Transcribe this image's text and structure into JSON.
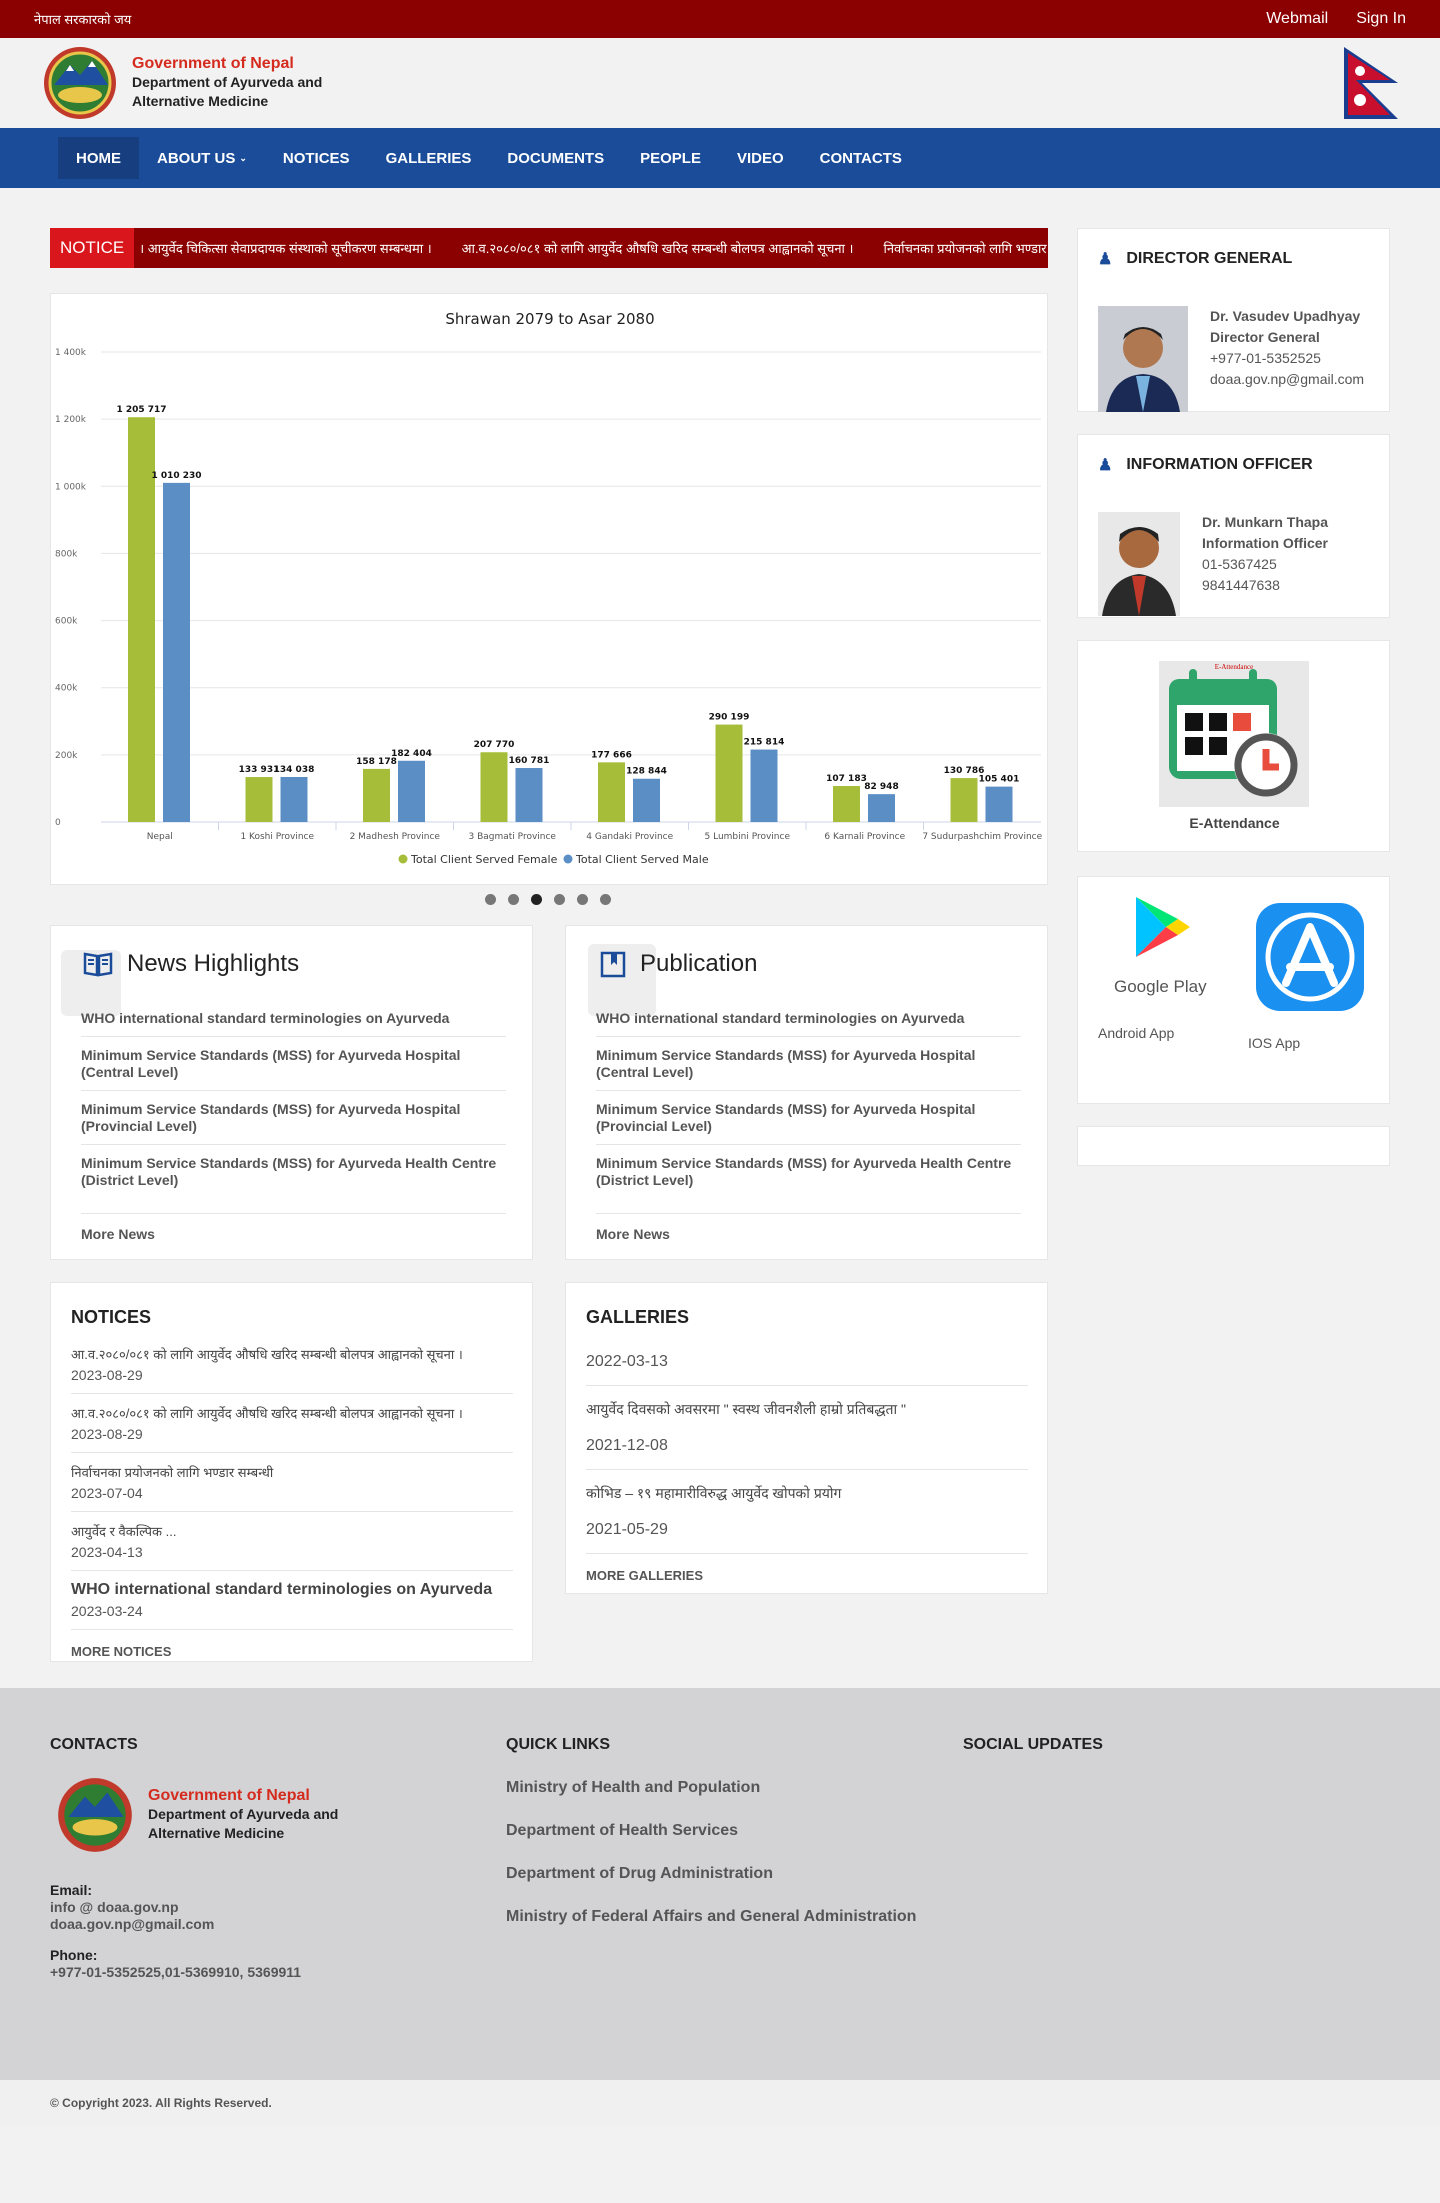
{
  "topbar": {
    "left_text": "नेपाल सरकारको जय",
    "webmail": "Webmail",
    "signin": "Sign In"
  },
  "brand": {
    "line1": "Government of Nepal",
    "line2": "Department of Ayurveda and",
    "line3": "Alternative Medicine"
  },
  "nav": {
    "items": [
      "HOME",
      "ABOUT US",
      "NOTICES",
      "GALLERIES",
      "DOCUMENTS",
      "PEOPLE",
      "VIDEO",
      "CONTACTS"
    ]
  },
  "ticker": {
    "label": "NOTICE",
    "items": [
      "। आयुर्वेद चिकित्सा सेवाप्रदायक संस्थाको सूचीकरण सम्बन्धमा ।",
      "आ.व.२०८०/०८१ को लागि आयुर्वेद औषधि खरिद सम्बन्धी बोलपत्र आह्वानको सूचना ।",
      "निर्वाचनका प्रयोजनको लागि भण्डार सम्बन्धी"
    ]
  },
  "chart_data": {
    "type": "bar",
    "title": "Shrawan 2079 to Asar 2080",
    "categories": [
      "Nepal",
      "1 Koshi Province",
      "2 Madhesh Province",
      "3 Bagmati Province",
      "4 Gandaki Province",
      "5 Lumbini Province",
      "6 Karnali Province",
      "7 Sudurpashchim Province"
    ],
    "series": [
      {
        "name": "Total Client Served Female",
        "color": "#a6bd3a",
        "values": [
          1205717,
          133931,
          158178,
          207770,
          177666,
          290199,
          107183,
          130786
        ],
        "labels": [
          "1 205 717",
          "133 931",
          "158 178",
          "207 770",
          "177 666",
          "290 199",
          "107 183",
          "130 786"
        ]
      },
      {
        "name": "Total Client Served Male",
        "color": "#5b8ec4",
        "values": [
          1010230,
          134038,
          182404,
          160781,
          128844,
          215814,
          82948,
          105401
        ],
        "labels": [
          "1 010 230",
          "134 038",
          "182 404",
          "160 781",
          "128 844",
          "215 814",
          "82 948",
          "105 401"
        ]
      }
    ],
    "yticks": [
      "0",
      "200k",
      "400k",
      "600k",
      "800k",
      "1 000k",
      "1 200k",
      "1 400k"
    ],
    "ylim": [
      0,
      1400000
    ],
    "grid": true,
    "legend": "bottom"
  },
  "news": {
    "title": "News Highlights",
    "items": [
      "WHO international standard terminologies on Ayurveda",
      "Minimum Service Standards (MSS) for Ayurveda Hospital (Central Level)",
      "Minimum Service Standards (MSS) for Ayurveda Hospital (Provincial Level)",
      "Minimum Service Standards (MSS) for Ayurveda Health Centre (District Level)"
    ],
    "more": "More News"
  },
  "publication": {
    "title": "Publication",
    "items": [
      "WHO international standard terminologies on Ayurveda",
      "Minimum Service Standards (MSS) for Ayurveda Hospital (Central Level)",
      "Minimum Service Standards (MSS) for Ayurveda Hospital (Provincial Level)",
      "Minimum Service Standards (MSS) for Ayurveda Health Centre (District Level)"
    ],
    "more": "More News"
  },
  "notices": {
    "title": "NOTICES",
    "items": [
      {
        "title": "आ.व.२०८०/०८१ को लागि आयुर्वेद औषधि खरिद सम्बन्धी बोलपत्र आह्वानको सूचना ।",
        "date": "2023-08-29"
      },
      {
        "title": "आ.व.२०८०/०८१ को लागि आयुर्वेद औषधि खरिद सम्बन्धी बोलपत्र आह्वानको सूचना ।",
        "date": "2023-08-29"
      },
      {
        "title": "निर्वाचनका प्रयोजनको लागि भण्डार सम्बन्धी",
        "date": "2023-07-04"
      },
      {
        "title": "आयुर्वेद र वैकल्पिक ...",
        "date": "2023-04-13"
      },
      {
        "title": "WHO international standard terminologies on Ayurveda",
        "date": "2023-03-24"
      }
    ],
    "more": "MORE NOTICES"
  },
  "galleries": {
    "title": "GALLERIES",
    "items": [
      {
        "title": "",
        "date": "2022-03-13"
      },
      {
        "title": "आयुर्वेद दिवसको अवसरमा \" स्वस्थ जीवनशैली हाम्रो प्रतिबद्धता \"",
        "date": "2021-12-08"
      },
      {
        "title": "कोभिड – १९ महामारीविरुद्ध आयुर्वेद खोपको प्रयोग",
        "date": "2021-05-29"
      }
    ],
    "more": "MORE GALLERIES"
  },
  "director": {
    "title": "DIRECTOR GENERAL",
    "name": "Dr. Vasudev Upadhyay",
    "role": "Director General",
    "phone": "+977-01-5352525",
    "email": "doaa.gov.np@gmail.com"
  },
  "info_officer": {
    "title": "INFORMATION OFFICER",
    "name": "Dr. Munkarn Thapa",
    "role": "Information Officer",
    "phone": "01-5367425",
    "mobile": "9841447638"
  },
  "attendance": {
    "label": "E-Attendance",
    "image_caption": "E-Attendance"
  },
  "apps": {
    "android": "Android App",
    "ios": "IOS App",
    "google_play": "Google Play"
  },
  "footer": {
    "contacts_title": "CONTACTS",
    "quick_links_title": "QUICK LINKS",
    "social_title": "SOCIAL UPDATES",
    "email_label": "Email:",
    "email1": "info @ doaa.gov.np",
    "email2": "doaa.gov.np@gmail.com",
    "phone_label": "Phone:",
    "phone": "+977-01-5352525,01-5369910, 5369911",
    "quick_links": [
      "Ministry of Health and Population",
      "Department of Health Services",
      "Department of Drug Administration",
      "Ministry of Federal Affairs and General Administration"
    ]
  },
  "copyright": "© Copyright 2023. All Rights Reserved."
}
